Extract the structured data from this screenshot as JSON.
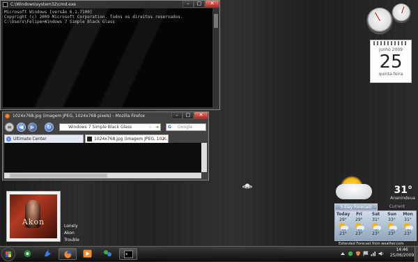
{
  "cmd": {
    "title": "C:\\Windows\\system32\\cmd.exe",
    "lines": [
      "Microsoft Windows [versão 6.1.7100]",
      "Copyright (c) 2009 Microsoft Corporation. Todos os direitos reservados.",
      "",
      "C:\\Users\\Felipe>Windows 7 Simple Black Glass"
    ]
  },
  "firefox": {
    "title": "1024x768.jpg (imagem JPEG, 1024x768 pixels) - Mozilla Firefox",
    "url": "Windows 7 Simple Black Glass",
    "search_placeholder": "Google",
    "tabs": [
      {
        "label": "Ultimate Center"
      },
      {
        "label": "1024x768.jpg (imagem JPEG, 102..."
      }
    ]
  },
  "calendar": {
    "month": "junho 2009",
    "day": "25",
    "weekday": "quinta-feira"
  },
  "weather": {
    "temp": "31°",
    "city": "Ananindeua",
    "tab_forecast": "5-Day Forecast",
    "tab_current": "Current Conditions",
    "days": [
      {
        "name": "Today",
        "hi": "29°",
        "lo": "23°"
      },
      {
        "name": "Fri",
        "hi": "29°",
        "lo": "23°"
      },
      {
        "name": "Sat",
        "hi": "31°",
        "lo": "23°"
      },
      {
        "name": "Sun",
        "hi": "33°",
        "lo": "23°"
      },
      {
        "name": "Mon",
        "hi": "31°",
        "lo": "23°"
      }
    ],
    "footer": "Extended Forecast from weather.com"
  },
  "media": {
    "cover_text": "Akon",
    "track": "Lonely",
    "artist": "Akon",
    "album": "Trouble"
  },
  "taskbar": {
    "time": "14:46",
    "date": "25/06/2009",
    "pinned": [
      "media-center-icon",
      "messenger-icon",
      "firefox-icon",
      "media-player-icon",
      "network-icon",
      "cmd-icon"
    ]
  }
}
